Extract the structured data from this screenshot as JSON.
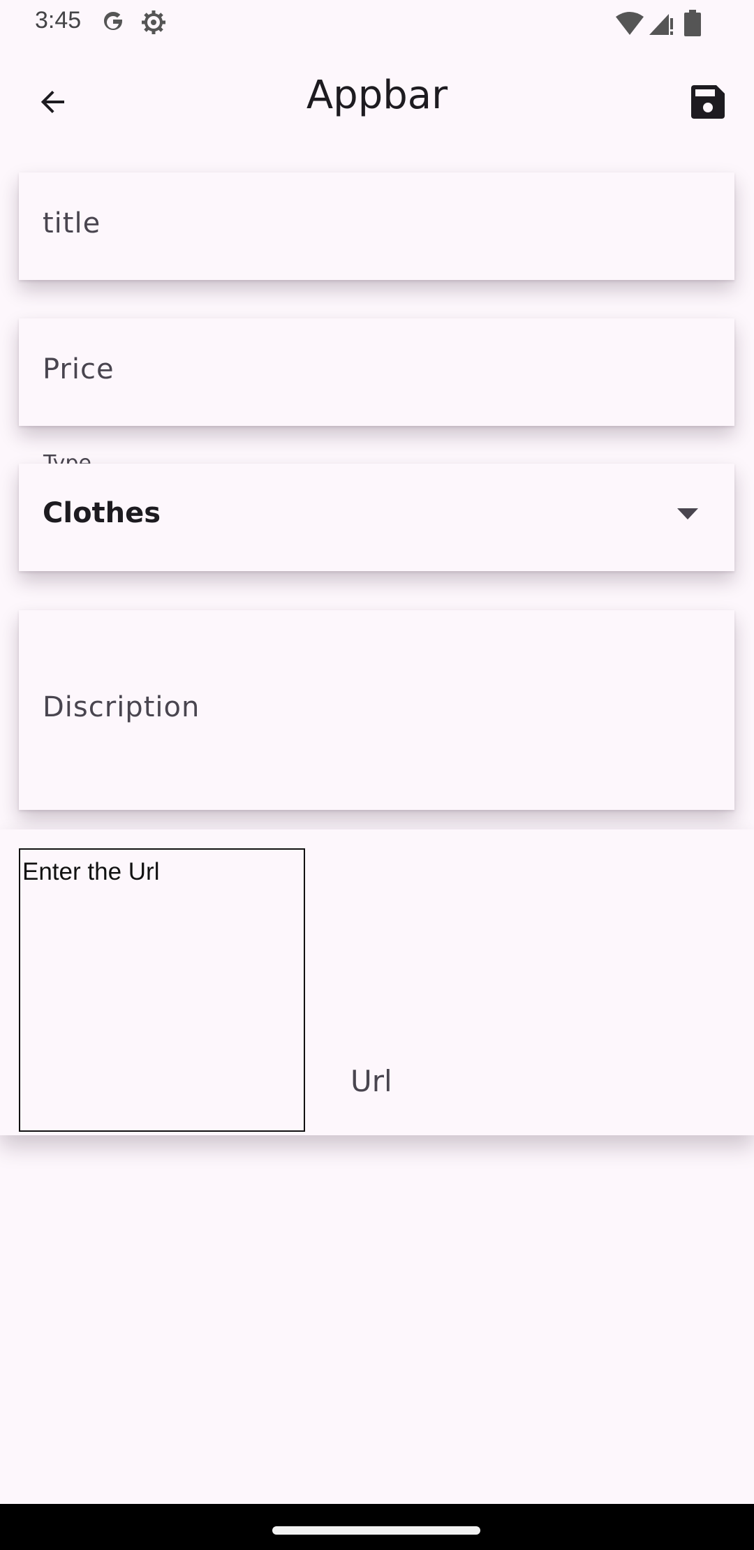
{
  "status_bar": {
    "time": "3:45",
    "icons": [
      "google-g-icon",
      "settings-gear-icon",
      "wifi-icon",
      "cell-signal-icon",
      "battery-icon"
    ]
  },
  "appbar": {
    "title": "Appbar",
    "back_icon": "arrow-back-icon",
    "save_icon": "save-floppy-icon"
  },
  "form": {
    "title_placeholder": "title",
    "price_placeholder": "Price",
    "type_label": "Type",
    "type_value": "Clothes",
    "description_placeholder": "Discription"
  },
  "url": {
    "box_text": "Enter the Url",
    "field_placeholder": "Url"
  },
  "colors": {
    "background": "#fdf7fc",
    "text": "#1d1b20",
    "hint": "#49454f"
  }
}
